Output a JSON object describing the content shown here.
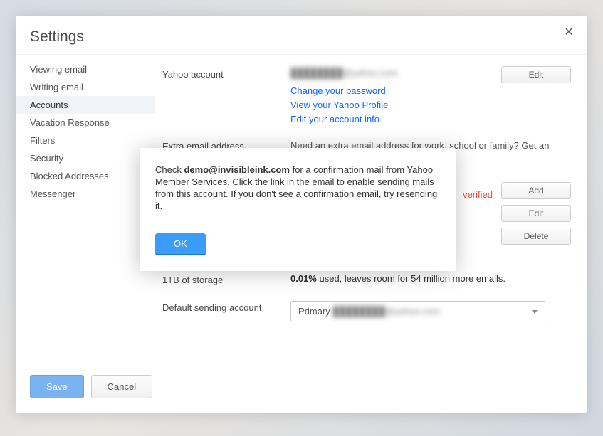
{
  "modal": {
    "title": "Settings",
    "close": "×"
  },
  "sidebar": {
    "items": [
      {
        "label": "Viewing email"
      },
      {
        "label": "Writing email"
      },
      {
        "label": "Accounts"
      },
      {
        "label": "Vacation Response"
      },
      {
        "label": "Filters"
      },
      {
        "label": "Security"
      },
      {
        "label": "Blocked Addresses"
      },
      {
        "label": "Messenger"
      }
    ],
    "active_index": 2
  },
  "content": {
    "yahoo_account": {
      "label": "Yahoo account",
      "account_value": "████████@yahoo.com",
      "edit_btn": "Edit",
      "links": [
        "Change your password",
        "View your Yahoo Profile",
        "Edit your account info"
      ]
    },
    "extra_email": {
      "label": "Extra email address",
      "description": "Need an extra email address for work, school or family? Get an ________ your existing email account.",
      "unverified": "verified",
      "add_btn": "Add",
      "edit_btn": "Edit",
      "delete_btn": "Delete"
    },
    "storage": {
      "label": "1TB of storage",
      "percent": "0.01%",
      "rest": " used, leaves room for 54 million more emails."
    },
    "default_sending": {
      "label": "Default sending account",
      "value_prefix": "Primary ",
      "value_blur": "████████@yahoo.com"
    }
  },
  "dialog": {
    "text_prefix": "Check ",
    "text_bold": "demo@invisibleink.com",
    "text_rest": " for a confirmation mail from Yahoo Member Services. Click the link in the email to enable sending mails from this account. If you don't see a confirmation email, try resending it.",
    "ok": "OK"
  },
  "footer": {
    "save": "Save",
    "cancel": "Cancel"
  }
}
